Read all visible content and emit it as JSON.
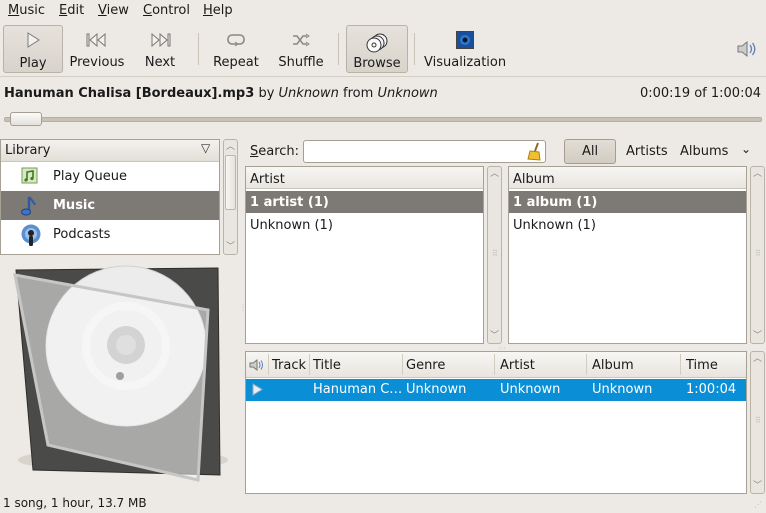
{
  "menubar": {
    "items": [
      {
        "label": "Music",
        "mnemonic": "M"
      },
      {
        "label": "Edit",
        "mnemonic": "E"
      },
      {
        "label": "View",
        "mnemonic": "V"
      },
      {
        "label": "Control",
        "mnemonic": "C"
      },
      {
        "label": "Help",
        "mnemonic": "H"
      }
    ]
  },
  "toolbar": {
    "play": "Play",
    "previous": "Previous",
    "next": "Next",
    "repeat": "Repeat",
    "shuffle": "Shuffle",
    "browse": "Browse",
    "visualization": "Visualization",
    "browse_pressed": true
  },
  "now_playing": {
    "title": "Hanuman Chalisa [Bordeaux].mp3",
    "by": "by",
    "artist": "Unknown",
    "from": "from",
    "album": "Unknown",
    "time": "0:00:19 of 1:00:04",
    "progress_fraction": 0.005
  },
  "library": {
    "header": "Library",
    "items": [
      {
        "label": "Play Queue",
        "icon": "play-queue-icon",
        "selected": false
      },
      {
        "label": "Music",
        "icon": "music-note-icon",
        "selected": true
      },
      {
        "label": "Podcasts",
        "icon": "podcast-icon",
        "selected": false
      }
    ]
  },
  "search": {
    "label": "Search:",
    "mnemonic": "S",
    "value": "",
    "placeholder": ""
  },
  "filters": {
    "all": "All",
    "artists": "Artists",
    "albums": "Albums",
    "more": "⌄"
  },
  "artist_pane": {
    "header": "Artist",
    "rows": [
      {
        "label": "1 artist (1)",
        "selected": true
      },
      {
        "label": "Unknown (1)",
        "selected": false
      }
    ]
  },
  "album_pane": {
    "header": "Album",
    "rows": [
      {
        "label": "1 album (1)",
        "selected": true
      },
      {
        "label": "Unknown (1)",
        "selected": false
      }
    ]
  },
  "tracklist": {
    "columns": [
      "Track",
      "Title",
      "Genre",
      "Artist",
      "Album",
      "Time"
    ],
    "rows": [
      {
        "playing": true,
        "track": "",
        "title": "Hanuman C…",
        "genre": "Unknown",
        "artist": "Unknown",
        "album": "Unknown",
        "time": "1:00:04"
      }
    ]
  },
  "status": "1 song, 1 hour, 13.7 MB",
  "colors": {
    "selection": "#0a8fd6",
    "source_selected": "#7d7a75",
    "background": "#edeae5"
  }
}
